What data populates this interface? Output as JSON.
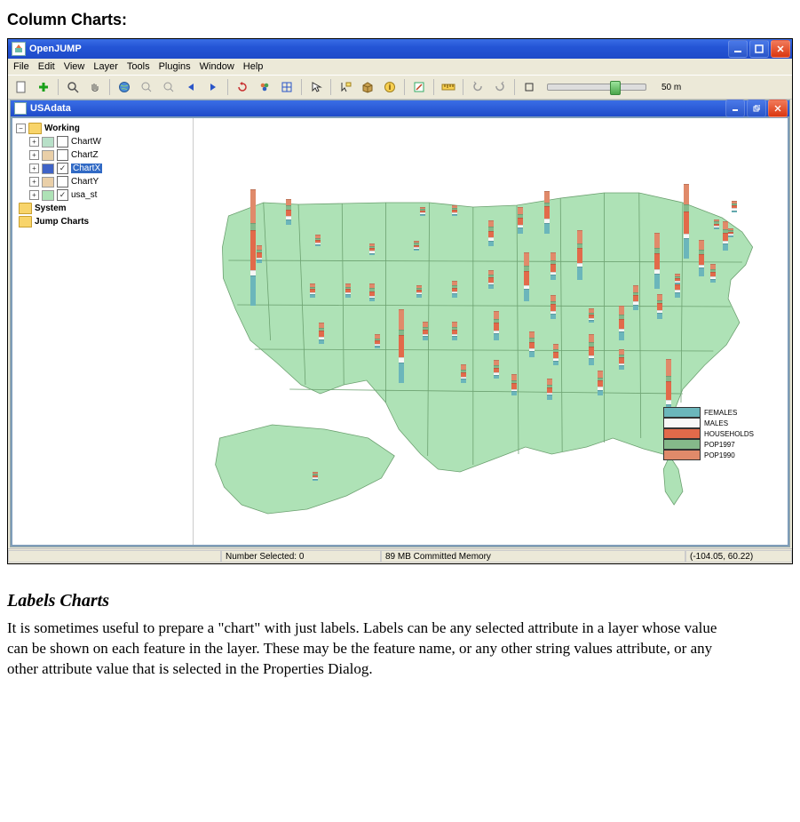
{
  "doc": {
    "heading": "Column Charts:",
    "subheading": "Labels Charts",
    "paragraph": "It is sometimes useful to prepare a \"chart\" with just labels.  Labels can be any selected attribute in a layer whose value can be shown on each feature in the layer.  These may be the feature name, or any other string values attribute, or any other attribute value that is selected in the Properties Dialog."
  },
  "app": {
    "title": "OpenJUMP",
    "child_title": "USAdata",
    "menu": {
      "file": "File",
      "edit": "Edit",
      "view": "View",
      "layer": "Layer",
      "tools": "Tools",
      "plugins": "Plugins",
      "window": "Window",
      "help": "Help"
    },
    "scale_label": "50 m"
  },
  "tree": {
    "root": "Working",
    "items": [
      {
        "label": "ChartW",
        "checked": false,
        "swatch": "#b8e0c8"
      },
      {
        "label": "ChartZ",
        "checked": false,
        "swatch": "#e9cfa8"
      },
      {
        "label": "ChartX",
        "checked": true,
        "swatch": "#3f63c7",
        "selected": true
      },
      {
        "label": "ChartY",
        "checked": false,
        "swatch": "#e9cfa8"
      },
      {
        "label": "usa_st",
        "checked": true,
        "swatch": "#aee2b6"
      }
    ],
    "system": "System",
    "jump_charts": "Jump Charts"
  },
  "legend": {
    "items": [
      {
        "label": "FEMALES",
        "color": "#6bb6bb"
      },
      {
        "label": "MALES",
        "color": "#f7f7f7"
      },
      {
        "label": "HOUSEHOLDS",
        "color": "#e26a4a"
      },
      {
        "label": "POP1997",
        "color": "#85b98a"
      },
      {
        "label": "POP1990",
        "color": "#e08a6a"
      }
    ]
  },
  "status": {
    "selected_label": "Number Selected: 0",
    "memory": "89 MB Committed Memory",
    "coords": "(-104.05, 60.22)"
  },
  "chart_data": {
    "type": "stacked_column_map",
    "series": [
      "FEMALES",
      "MALES",
      "HOUSEHOLDS",
      "POP1997",
      "POP1990"
    ],
    "colors": {
      "FEMALES": "#6bb6bb",
      "MALES": "#f7f7f7",
      "HOUSEHOLDS": "#e26a4a",
      "POP1997": "#85b98a",
      "POP1990": "#e08a6a"
    },
    "units": "relative (pixel heights approximated from screenshot)",
    "points": [
      {
        "x_pct": 10.0,
        "y_pct": 44.0,
        "values": {
          "FEMALES": 30,
          "MALES": 5,
          "HOUSEHOLDS": 40,
          "POP1997": 6,
          "POP1990": 34
        }
      },
      {
        "x_pct": 11.0,
        "y_pct": 34.0,
        "values": {
          "FEMALES": 3,
          "MALES": 1,
          "HOUSEHOLDS": 4,
          "POP1997": 2,
          "POP1990": 4
        }
      },
      {
        "x_pct": 16.0,
        "y_pct": 25.0,
        "values": {
          "FEMALES": 5,
          "MALES": 2,
          "HOUSEHOLDS": 6,
          "POP1997": 3,
          "POP1990": 6
        }
      },
      {
        "x_pct": 20.0,
        "y_pct": 42.0,
        "values": {
          "FEMALES": 2,
          "MALES": 1,
          "HOUSEHOLDS": 3,
          "POP1997": 1,
          "POP1990": 3
        }
      },
      {
        "x_pct": 21.0,
        "y_pct": 30.0,
        "values": {
          "FEMALES": 1,
          "MALES": 1,
          "HOUSEHOLDS": 2,
          "POP1997": 1,
          "POP1990": 2
        }
      },
      {
        "x_pct": 21.5,
        "y_pct": 53.0,
        "values": {
          "FEMALES": 4,
          "MALES": 2,
          "HOUSEHOLDS": 5,
          "POP1997": 2,
          "POP1990": 5
        }
      },
      {
        "x_pct": 26.0,
        "y_pct": 42.0,
        "values": {
          "FEMALES": 2,
          "MALES": 1,
          "HOUSEHOLDS": 3,
          "POP1997": 1,
          "POP1990": 3
        }
      },
      {
        "x_pct": 30.0,
        "y_pct": 32.0,
        "values": {
          "FEMALES": 1,
          "MALES": 1,
          "HOUSEHOLDS": 2,
          "POP1997": 1,
          "POP1990": 2
        }
      },
      {
        "x_pct": 30.0,
        "y_pct": 43.0,
        "values": {
          "FEMALES": 3,
          "MALES": 1,
          "HOUSEHOLDS": 4,
          "POP1997": 2,
          "POP1990": 4
        }
      },
      {
        "x_pct": 31.0,
        "y_pct": 54.0,
        "values": {
          "FEMALES": 2,
          "MALES": 1,
          "HOUSEHOLDS": 3,
          "POP1997": 1,
          "POP1990": 3
        }
      },
      {
        "x_pct": 35.0,
        "y_pct": 62.0,
        "values": {
          "FEMALES": 20,
          "MALES": 4,
          "HOUSEHOLDS": 22,
          "POP1997": 5,
          "POP1990": 20
        }
      },
      {
        "x_pct": 37.5,
        "y_pct": 31.0,
        "values": {
          "FEMALES": 1,
          "MALES": 1,
          "HOUSEHOLDS": 1,
          "POP1997": 1,
          "POP1990": 1
        }
      },
      {
        "x_pct": 38.0,
        "y_pct": 42.0,
        "values": {
          "FEMALES": 2,
          "MALES": 1,
          "HOUSEHOLDS": 2,
          "POP1997": 1,
          "POP1990": 2
        }
      },
      {
        "x_pct": 39.0,
        "y_pct": 52.0,
        "values": {
          "FEMALES": 3,
          "MALES": 1,
          "HOUSEHOLDS": 4,
          "POP1997": 2,
          "POP1990": 4
        }
      },
      {
        "x_pct": 38.5,
        "y_pct": 23.0,
        "values": {
          "FEMALES": 1,
          "MALES": 1,
          "HOUSEHOLDS": 1,
          "POP1997": 1,
          "POP1990": 1
        }
      },
      {
        "x_pct": 44.0,
        "y_pct": 23.0,
        "values": {
          "FEMALES": 1,
          "MALES": 1,
          "HOUSEHOLDS": 2,
          "POP1997": 1,
          "POP1990": 2
        }
      },
      {
        "x_pct": 44.0,
        "y_pct": 42.0,
        "values": {
          "FEMALES": 3,
          "MALES": 1,
          "HOUSEHOLDS": 3,
          "POP1997": 2,
          "POP1990": 3
        }
      },
      {
        "x_pct": 44.0,
        "y_pct": 52.0,
        "values": {
          "FEMALES": 3,
          "MALES": 1,
          "HOUSEHOLDS": 4,
          "POP1997": 2,
          "POP1990": 4
        }
      },
      {
        "x_pct": 45.5,
        "y_pct": 62.0,
        "values": {
          "FEMALES": 3,
          "MALES": 1,
          "HOUSEHOLDS": 4,
          "POP1997": 2,
          "POP1990": 4
        }
      },
      {
        "x_pct": 50.0,
        "y_pct": 30.0,
        "values": {
          "FEMALES": 5,
          "MALES": 2,
          "HOUSEHOLDS": 6,
          "POP1997": 3,
          "POP1990": 6
        }
      },
      {
        "x_pct": 50.0,
        "y_pct": 40.0,
        "values": {
          "FEMALES": 4,
          "MALES": 1,
          "HOUSEHOLDS": 4,
          "POP1997": 2,
          "POP1990": 4
        }
      },
      {
        "x_pct": 51.0,
        "y_pct": 52.0,
        "values": {
          "FEMALES": 6,
          "MALES": 2,
          "HOUSEHOLDS": 7,
          "POP1997": 3,
          "POP1990": 7
        }
      },
      {
        "x_pct": 51.0,
        "y_pct": 61.0,
        "values": {
          "FEMALES": 3,
          "MALES": 1,
          "HOUSEHOLDS": 4,
          "POP1997": 2,
          "POP1990": 4
        }
      },
      {
        "x_pct": 55.0,
        "y_pct": 27.0,
        "values": {
          "FEMALES": 5,
          "MALES": 2,
          "HOUSEHOLDS": 6,
          "POP1997": 3,
          "POP1990": 6
        }
      },
      {
        "x_pct": 56.0,
        "y_pct": 43.0,
        "values": {
          "FEMALES": 12,
          "MALES": 3,
          "HOUSEHOLDS": 14,
          "POP1997": 4,
          "POP1990": 13
        }
      },
      {
        "x_pct": 57.0,
        "y_pct": 56.0,
        "values": {
          "FEMALES": 5,
          "MALES": 2,
          "HOUSEHOLDS": 6,
          "POP1997": 3,
          "POP1990": 6
        }
      },
      {
        "x_pct": 54.0,
        "y_pct": 65.0,
        "values": {
          "FEMALES": 4,
          "MALES": 1,
          "HOUSEHOLDS": 5,
          "POP1997": 2,
          "POP1990": 5
        }
      },
      {
        "x_pct": 59.5,
        "y_pct": 27.0,
        "values": {
          "FEMALES": 10,
          "MALES": 3,
          "HOUSEHOLDS": 12,
          "POP1997": 3,
          "POP1990": 11
        }
      },
      {
        "x_pct": 60.5,
        "y_pct": 47.0,
        "values": {
          "FEMALES": 4,
          "MALES": 2,
          "HOUSEHOLDS": 6,
          "POP1997": 2,
          "POP1990": 6
        }
      },
      {
        "x_pct": 60.5,
        "y_pct": 38.0,
        "values": {
          "FEMALES": 5,
          "MALES": 2,
          "HOUSEHOLDS": 7,
          "POP1997": 3,
          "POP1990": 7
        }
      },
      {
        "x_pct": 61.0,
        "y_pct": 58.0,
        "values": {
          "FEMALES": 4,
          "MALES": 2,
          "HOUSEHOLDS": 5,
          "POP1997": 2,
          "POP1990": 5
        }
      },
      {
        "x_pct": 60.0,
        "y_pct": 66.0,
        "values": {
          "FEMALES": 4,
          "MALES": 1,
          "HOUSEHOLDS": 5,
          "POP1997": 2,
          "POP1990": 5
        }
      },
      {
        "x_pct": 65.0,
        "y_pct": 38.0,
        "values": {
          "FEMALES": 13,
          "MALES": 3,
          "HOUSEHOLDS": 14,
          "POP1997": 4,
          "POP1990": 13
        }
      },
      {
        "x_pct": 67.0,
        "y_pct": 48.0,
        "values": {
          "FEMALES": 2,
          "MALES": 1,
          "HOUSEHOLDS": 3,
          "POP1997": 1,
          "POP1990": 3
        }
      },
      {
        "x_pct": 67.0,
        "y_pct": 58.0,
        "values": {
          "FEMALES": 7,
          "MALES": 2,
          "HOUSEHOLDS": 8,
          "POP1997": 3,
          "POP1990": 8
        }
      },
      {
        "x_pct": 68.5,
        "y_pct": 65.0,
        "values": {
          "FEMALES": 5,
          "MALES": 2,
          "HOUSEHOLDS": 6,
          "POP1997": 2,
          "POP1990": 6
        }
      },
      {
        "x_pct": 72.0,
        "y_pct": 52.0,
        "values": {
          "FEMALES": 8,
          "MALES": 2,
          "HOUSEHOLDS": 9,
          "POP1997": 3,
          "POP1990": 9
        }
      },
      {
        "x_pct": 72.0,
        "y_pct": 59.0,
        "values": {
          "FEMALES": 4,
          "MALES": 1,
          "HOUSEHOLDS": 5,
          "POP1997": 2,
          "POP1990": 5
        }
      },
      {
        "x_pct": 74.5,
        "y_pct": 45.0,
        "values": {
          "FEMALES": 5,
          "MALES": 2,
          "HOUSEHOLDS": 6,
          "POP1997": 2,
          "POP1990": 6
        }
      },
      {
        "x_pct": 78.0,
        "y_pct": 40.0,
        "values": {
          "FEMALES": 15,
          "MALES": 3,
          "HOUSEHOLDS": 16,
          "POP1997": 4,
          "POP1990": 15
        }
      },
      {
        "x_pct": 80.0,
        "y_pct": 71.0,
        "values": {
          "FEMALES": 16,
          "MALES": 4,
          "HOUSEHOLDS": 18,
          "POP1997": 5,
          "POP1990": 16
        }
      },
      {
        "x_pct": 78.5,
        "y_pct": 47.0,
        "values": {
          "FEMALES": 5,
          "MALES": 2,
          "HOUSEHOLDS": 6,
          "POP1997": 2,
          "POP1990": 6
        }
      },
      {
        "x_pct": 81.5,
        "y_pct": 42.0,
        "values": {
          "FEMALES": 4,
          "MALES": 2,
          "HOUSEHOLDS": 5,
          "POP1997": 2,
          "POP1990": 5
        }
      },
      {
        "x_pct": 81.5,
        "y_pct": 39.0,
        "values": {
          "FEMALES": 1,
          "MALES": 1,
          "HOUSEHOLDS": 2,
          "POP1997": 1,
          "POP1990": 2
        }
      },
      {
        "x_pct": 83.0,
        "y_pct": 33.0,
        "values": {
          "FEMALES": 20,
          "MALES": 4,
          "HOUSEHOLDS": 22,
          "POP1997": 6,
          "POP1990": 20
        }
      },
      {
        "x_pct": 85.5,
        "y_pct": 37.0,
        "values": {
          "FEMALES": 8,
          "MALES": 2,
          "HOUSEHOLDS": 10,
          "POP1997": 3,
          "POP1990": 9
        }
      },
      {
        "x_pct": 87.5,
        "y_pct": 38.5,
        "values": {
          "FEMALES": 3,
          "MALES": 1,
          "HOUSEHOLDS": 4,
          "POP1997": 2,
          "POP1990": 4
        }
      },
      {
        "x_pct": 89.5,
        "y_pct": 31.0,
        "values": {
          "FEMALES": 6,
          "MALES": 2,
          "HOUSEHOLDS": 7,
          "POP1997": 3,
          "POP1990": 7
        }
      },
      {
        "x_pct": 90.5,
        "y_pct": 28.0,
        "values": {
          "FEMALES": 1,
          "MALES": 1,
          "HOUSEHOLDS": 1,
          "POP1997": 1,
          "POP1990": 1
        }
      },
      {
        "x_pct": 91.0,
        "y_pct": 22.0,
        "values": {
          "FEMALES": 1,
          "MALES": 1,
          "HOUSEHOLDS": 2,
          "POP1997": 1,
          "POP1990": 2
        }
      },
      {
        "x_pct": 88.0,
        "y_pct": 26.0,
        "values": {
          "FEMALES": 1,
          "MALES": 1,
          "HOUSEHOLDS": 1,
          "POP1997": 1,
          "POP1990": 1
        }
      },
      {
        "x_pct": 20.5,
        "y_pct": 85.0,
        "values": {
          "FEMALES": 1,
          "MALES": 1,
          "HOUSEHOLDS": 1,
          "POP1997": 1,
          "POP1990": 1
        }
      }
    ]
  }
}
